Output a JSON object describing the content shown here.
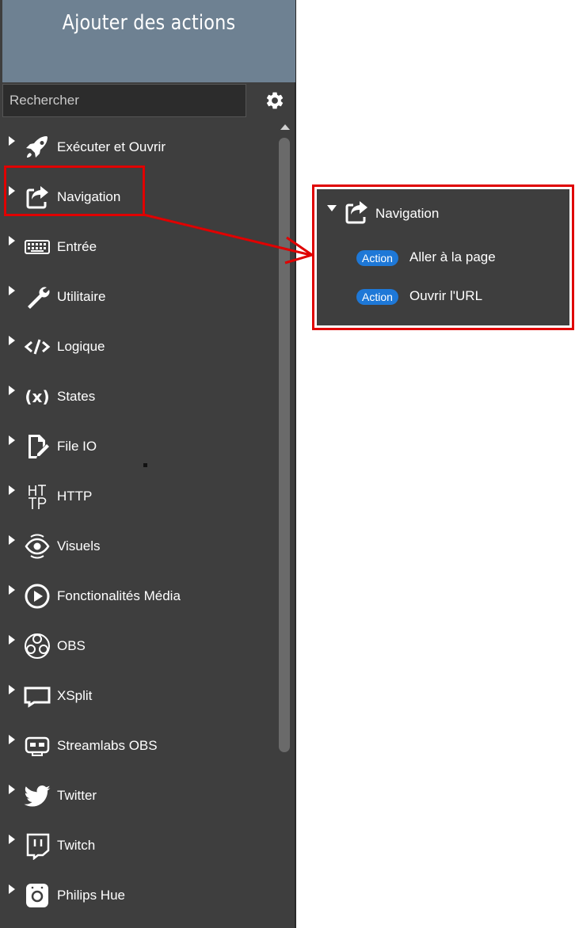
{
  "header": {
    "title": "Ajouter des actions"
  },
  "search": {
    "placeholder": "Rechercher",
    "value": ""
  },
  "settings": {
    "icon": "gear-icon"
  },
  "categories": [
    {
      "label": "Exécuter et Ouvrir",
      "icon": "rocket-icon"
    },
    {
      "label": "Navigation",
      "icon": "share-icon"
    },
    {
      "label": "Entrée",
      "icon": "keyboard-icon"
    },
    {
      "label": "Utilitaire",
      "icon": "wrench-icon"
    },
    {
      "label": "Logique",
      "icon": "code-icon"
    },
    {
      "label": "States",
      "icon": "variable-icon"
    },
    {
      "label": "File IO",
      "icon": "file-edit-icon"
    },
    {
      "label": "HTTP",
      "icon": "http-icon"
    },
    {
      "label": "Visuels",
      "icon": "eye-icon"
    },
    {
      "label": "Fonctionalités Média",
      "icon": "play-icon"
    },
    {
      "label": "OBS",
      "icon": "obs-icon"
    },
    {
      "label": "XSplit",
      "icon": "xsplit-icon"
    },
    {
      "label": "Streamlabs OBS",
      "icon": "streamlabs-icon"
    },
    {
      "label": "Twitter",
      "icon": "twitter-icon"
    },
    {
      "label": "Twitch",
      "icon": "twitch-icon"
    },
    {
      "label": "Philips Hue",
      "icon": "hue-bridge-icon"
    }
  ],
  "expanded": {
    "title": "Navigation",
    "icon": "share-icon",
    "actions": [
      {
        "badge": "Action",
        "label": "Aller à la page"
      },
      {
        "badge": "Action",
        "label": "Ouvrir l'URL"
      }
    ]
  },
  "colors": {
    "highlight": "#e00000",
    "badge": "#1e78d7",
    "panel": "#3e3e3e",
    "header": "#6e8192"
  }
}
